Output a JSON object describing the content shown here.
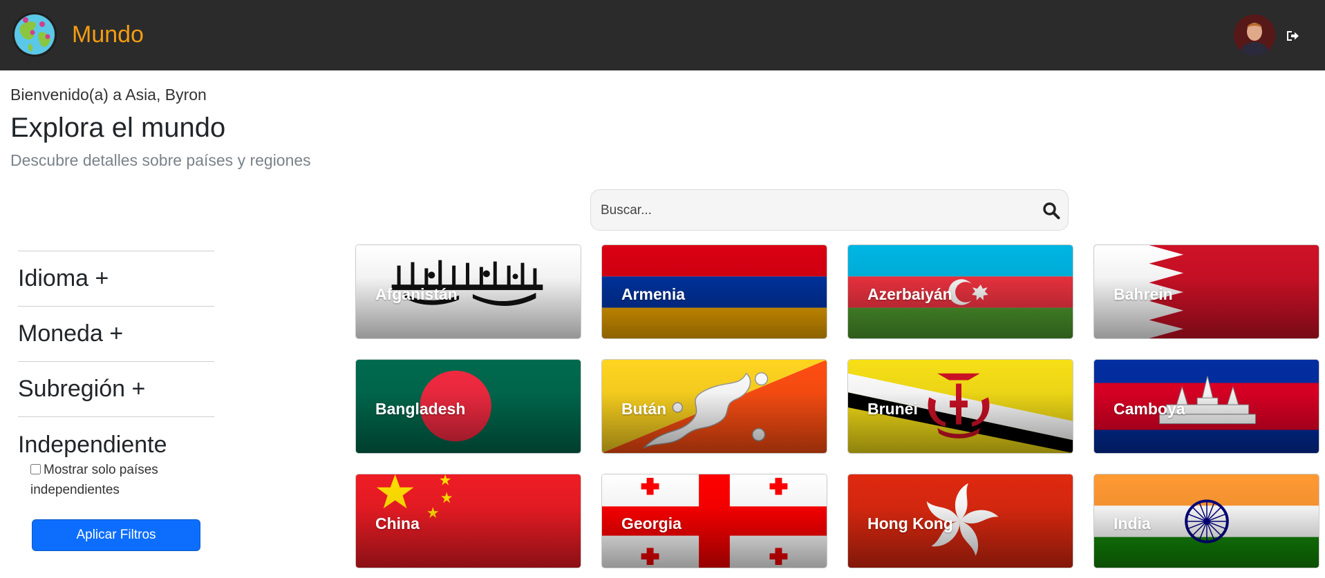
{
  "app": {
    "brand": "Mundo"
  },
  "header": {
    "welcome": "Bienvenido(a) a Asia, Byron",
    "title": "Explora el mundo",
    "subtitle": "Descubre detalles sobre países y regiones"
  },
  "search": {
    "placeholder": "Buscar...",
    "value": ""
  },
  "filters": {
    "items": [
      "Idioma +",
      "Moneda +",
      "Subregión +"
    ],
    "independiente": {
      "title": "Independiente",
      "checkbox_label": "Mostrar solo países independientes",
      "checked": false
    },
    "apply_label": "Aplicar Filtros",
    "apply_color": "#0d6efd"
  },
  "countries": [
    {
      "name": "Afganistán",
      "flag": "afghanistan-flag"
    },
    {
      "name": "Armenia",
      "flag": "armenia-flag"
    },
    {
      "name": "Azerbaiyán",
      "flag": "azerbaijan-flag"
    },
    {
      "name": "Bahrein",
      "flag": "bahrain-flag"
    },
    {
      "name": "Bangladesh",
      "flag": "bangladesh-flag"
    },
    {
      "name": "Bután",
      "flag": "bhutan-flag"
    },
    {
      "name": "Brunei",
      "flag": "brunei-flag"
    },
    {
      "name": "Camboya",
      "flag": "cambodia-flag"
    },
    {
      "name": "China",
      "flag": "china-flag"
    },
    {
      "name": "Georgia",
      "flag": "georgia-flag"
    },
    {
      "name": "Hong Kong",
      "flag": "hong-kong-flag"
    },
    {
      "name": "India",
      "flag": "india-flag"
    }
  ],
  "colors": {
    "navbar": "#2b2b2b",
    "brand": "#f39c12",
    "accent": "#0d6efd"
  }
}
